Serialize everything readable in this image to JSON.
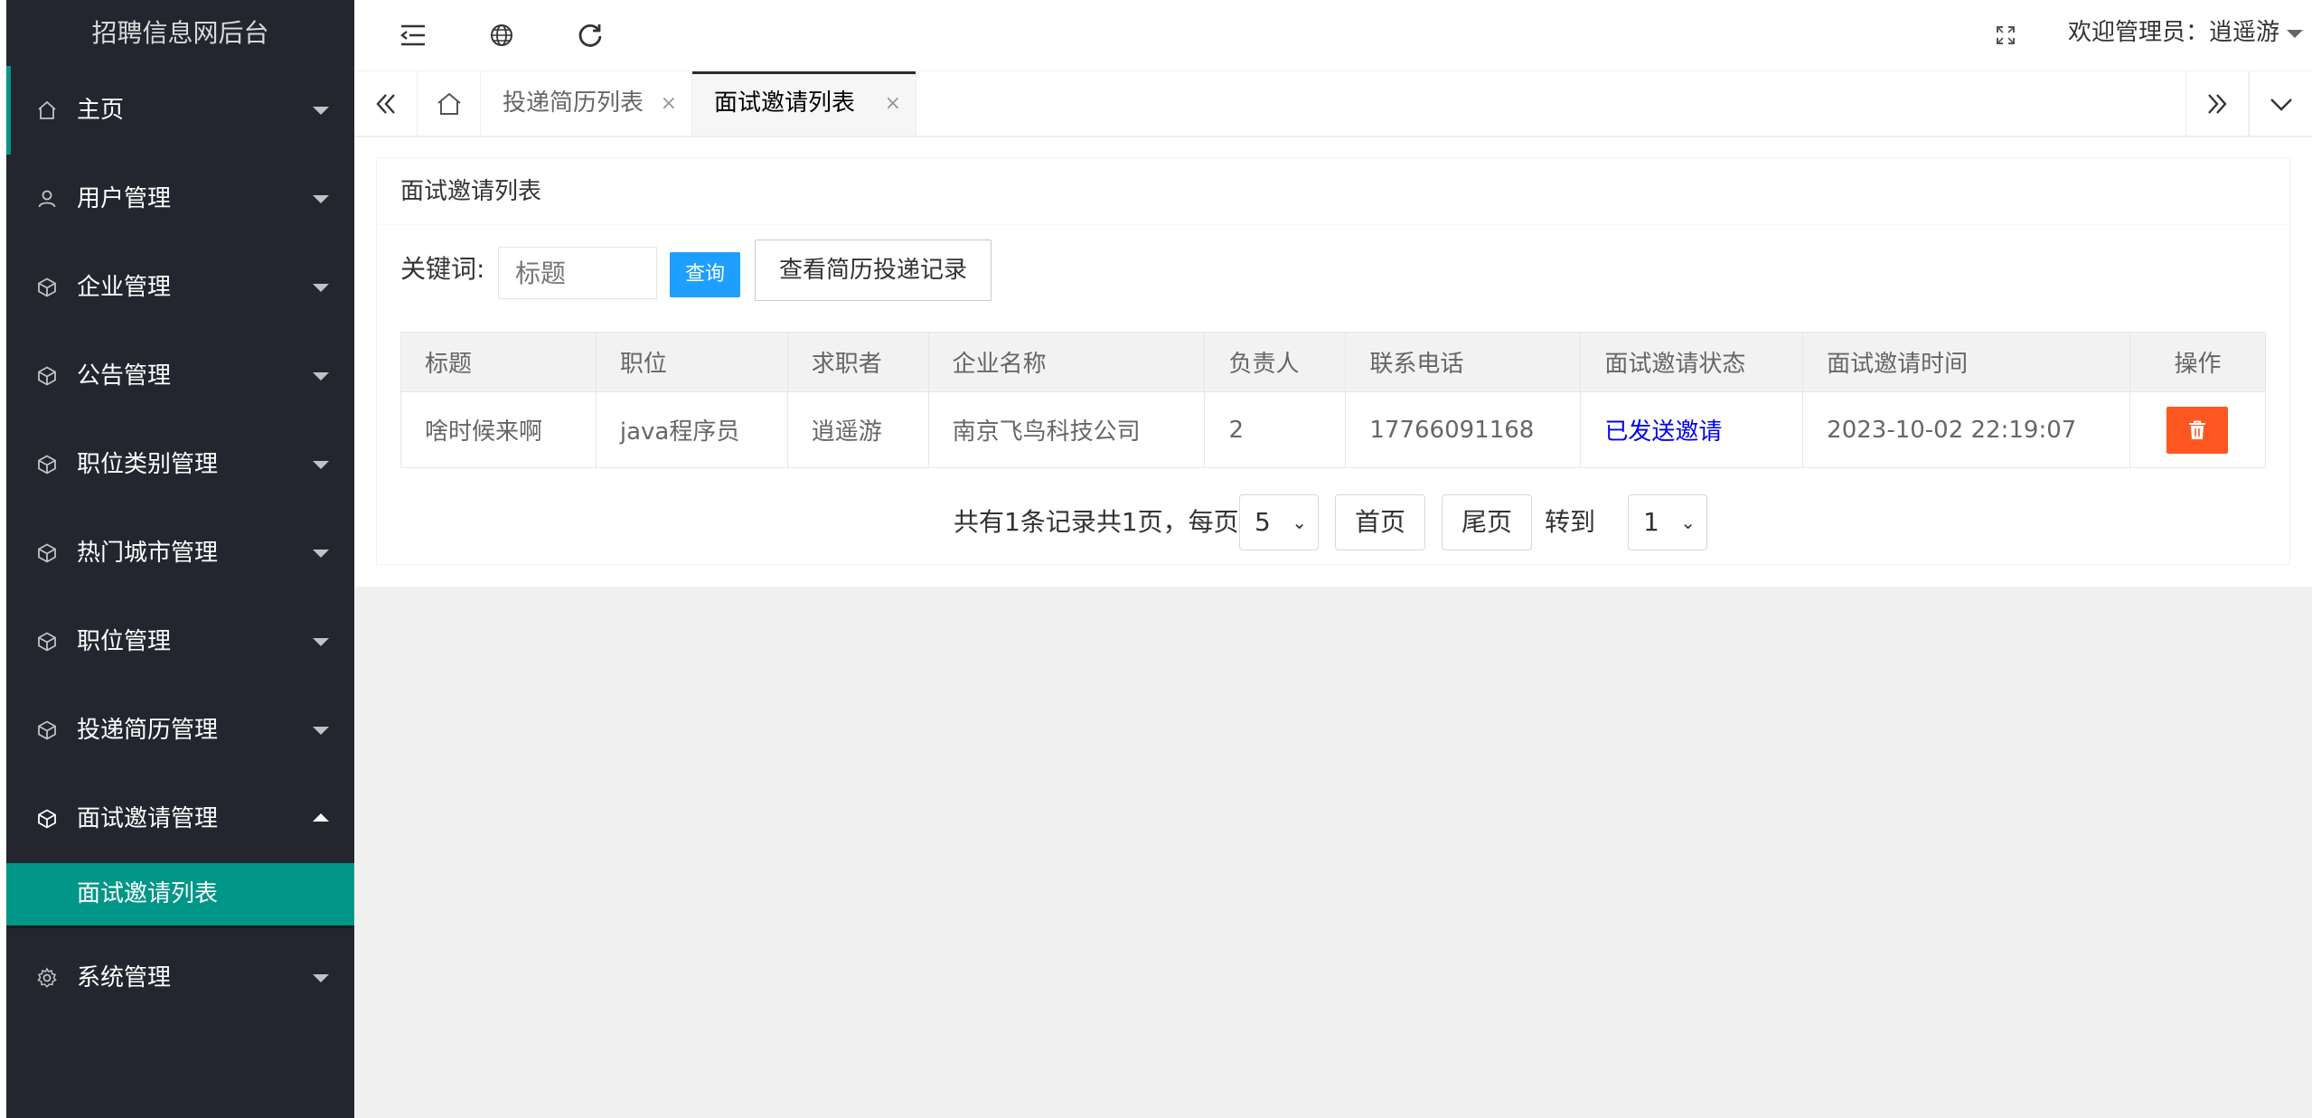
{
  "app": {
    "title": "招聘信息网后台"
  },
  "sidebar": {
    "items": [
      {
        "label": "主页",
        "icon": "home-icon"
      },
      {
        "label": "用户管理",
        "icon": "user-icon"
      },
      {
        "label": "企业管理",
        "icon": "cube-icon"
      },
      {
        "label": "公告管理",
        "icon": "cube-icon"
      },
      {
        "label": "职位类别管理",
        "icon": "cube-icon"
      },
      {
        "label": "热门城市管理",
        "icon": "cube-icon"
      },
      {
        "label": "职位管理",
        "icon": "cube-icon"
      },
      {
        "label": "投递简历管理",
        "icon": "cube-icon"
      },
      {
        "label": "面试邀请管理",
        "icon": "cube-icon",
        "expanded": true
      },
      {
        "label": "系统管理",
        "icon": "gear-icon"
      }
    ],
    "subitems": [
      {
        "label": "面试邀请列表",
        "active": true
      }
    ],
    "active_color": "#009688"
  },
  "header": {
    "icons": [
      "collapse-menu-icon",
      "globe-icon",
      "refresh-icon",
      "fullscreen-icon"
    ],
    "welcome": "欢迎管理员：逍遥游"
  },
  "tabs": [
    {
      "label": "投递简历列表",
      "close": "×"
    },
    {
      "label": "面试邀请列表",
      "close": "×",
      "active": true
    }
  ],
  "card": {
    "title": "面试邀请列表",
    "search": {
      "label": "关键词:",
      "placeholder": "标题",
      "value": "",
      "query_label": "查询",
      "history_label": "查看简历投递记录"
    },
    "table": {
      "headers": [
        "标题",
        "职位",
        "求职者",
        "企业名称",
        "负责人",
        "联系电话",
        "面试邀请状态",
        "面试邀请时间",
        "操作"
      ],
      "rows": [
        [
          "啥时候来啊",
          "java程序员",
          "逍遥游",
          "南京飞鸟科技公司",
          "2",
          "17766091168",
          "已发送邀请",
          "2023-10-02 22:19:07"
        ]
      ]
    },
    "pager": {
      "summary": "共有1条记录共1页，每页",
      "page_size": "5",
      "first": "首页",
      "last": "尾页",
      "goto": "转到",
      "page": "1"
    }
  },
  "colors": {
    "primary_blue": "#1e9fff",
    "danger": "#ff5722",
    "sidebar_bg": "#23262e",
    "status_link": "#0000ee"
  }
}
